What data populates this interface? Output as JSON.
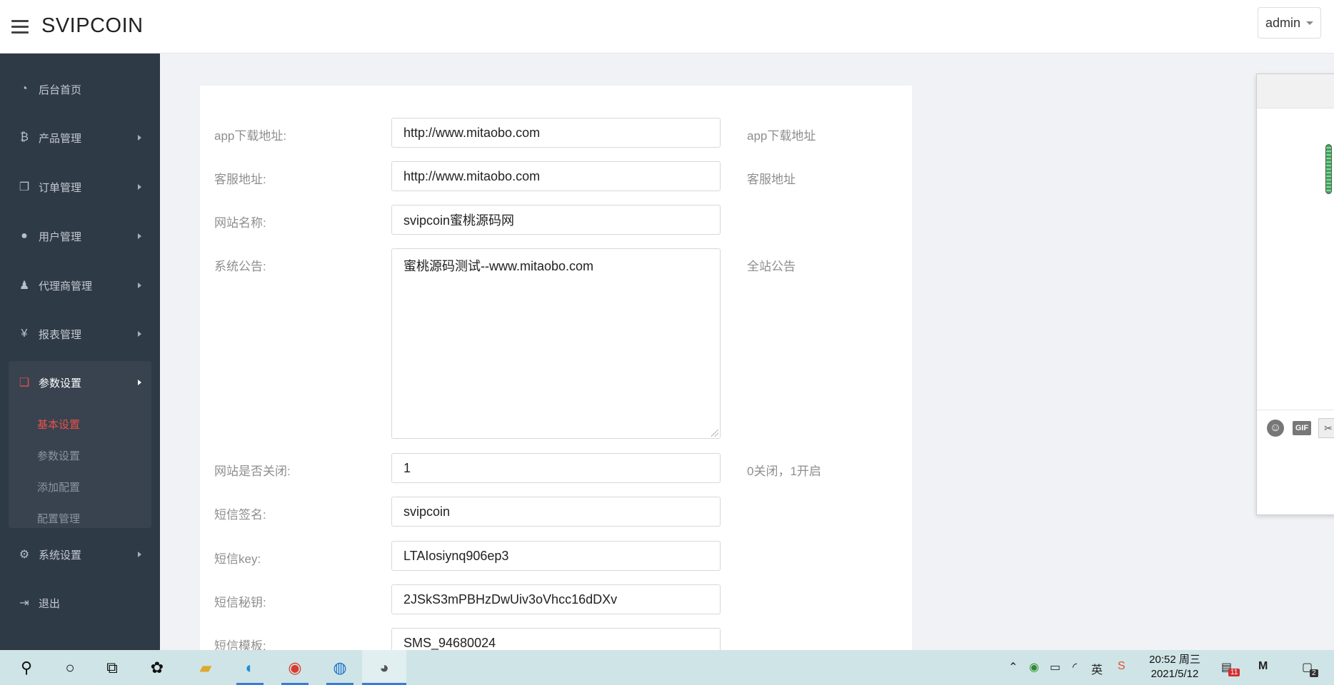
{
  "header": {
    "brand": "SVIPCOIN",
    "user": "admin"
  },
  "sidebar": {
    "items": [
      {
        "label": "后台首页",
        "icon": "dashboard-icon"
      },
      {
        "label": "产品管理",
        "icon": "bitcoin-icon"
      },
      {
        "label": "订单管理",
        "icon": "copy-icon"
      },
      {
        "label": "用户管理",
        "icon": "user-icon"
      },
      {
        "label": "代理商管理",
        "icon": "agent-icon"
      },
      {
        "label": "报表管理",
        "icon": "yen-icon"
      },
      {
        "label": "参数设置",
        "icon": "paste-icon"
      },
      {
        "label": "系统设置",
        "icon": "gears-icon"
      },
      {
        "label": "退出",
        "icon": "sign-out-icon"
      }
    ],
    "sub_items": [
      "基本设置",
      "参数设置",
      "添加配置",
      "配置管理"
    ]
  },
  "form": {
    "rows": [
      {
        "label": "app下载地址:",
        "value": "http://www.mitaobo.com",
        "hint": "app下载地址"
      },
      {
        "label": "客服地址:",
        "value": "http://www.mitaobo.com",
        "hint": "客服地址"
      },
      {
        "label": "网站名称:",
        "value": "svipcoin蜜桃源码网",
        "hint": ""
      },
      {
        "label": "系统公告:",
        "value": "蜜桃源码测试--www.mitaobo.com",
        "hint": "全站公告"
      },
      {
        "label": "网站是否关闭:",
        "value": "1",
        "hint": "0关闭，1开启"
      },
      {
        "label": "短信签名:",
        "value": "svipcoin",
        "hint": ""
      },
      {
        "label": "短信key:",
        "value": "LTAIosiynq906ep3",
        "hint": ""
      },
      {
        "label": "短信秘钥:",
        "value": "2JSkS3mPBHzDwUiv3oVhcc16dDXv",
        "hint": ""
      },
      {
        "label": "短信模板:",
        "value": "SMS_94680024",
        "hint": ""
      }
    ]
  },
  "float_panel": {
    "gif_label": "GIF"
  },
  "taskbar": {
    "time": "20:52 周三",
    "date": "2021/5/12",
    "ime": "英",
    "mail_badge": "11",
    "notify_badge": "2"
  }
}
